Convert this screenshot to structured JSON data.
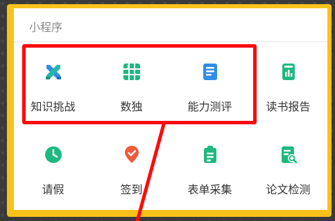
{
  "section": {
    "title": "小程序"
  },
  "colors": {
    "frame": "#F8C21B",
    "highlight": "#FF0A0A",
    "tile_teal": "#23B9A6",
    "tile_green": "#1EB97F",
    "tile_blue": "#2F8EE8",
    "tile_orange": "#F05A3A"
  },
  "apps": [
    {
      "label": "知识挑战",
      "icon": "crossed-swords-icon"
    },
    {
      "label": "数独",
      "icon": "sudoku-grid-icon"
    },
    {
      "label": "能力测评",
      "icon": "assessment-doc-icon"
    },
    {
      "label": "读书报告",
      "icon": "book-report-icon"
    },
    {
      "label": "请假",
      "icon": "clock-icon"
    },
    {
      "label": "签到",
      "icon": "checkin-pin-icon"
    },
    {
      "label": "表单采集",
      "icon": "clipboard-list-icon"
    },
    {
      "label": "论文检测",
      "icon": "document-search-icon"
    }
  ]
}
